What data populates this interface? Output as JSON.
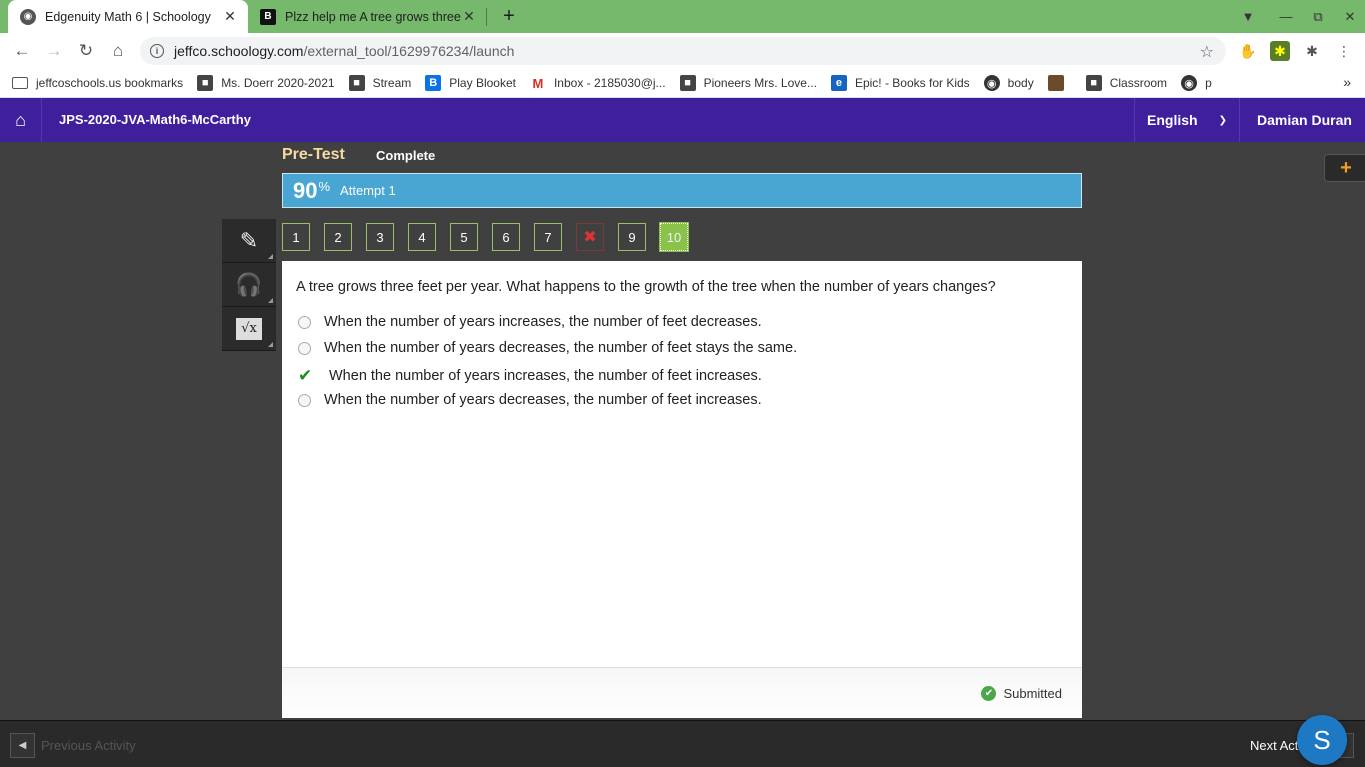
{
  "browser": {
    "tabs": [
      {
        "title": "Edgenuity Math 6 | Schoology",
        "active": true
      },
      {
        "title": "Plzz help me A tree grows three f",
        "active": false
      }
    ],
    "url_host": "jeffco.schoology.com",
    "url_path": "/external_tool/1629976234/launch",
    "bookmarks": [
      {
        "label": "jeffcoschools.us bookmarks",
        "icon": "folder-icon"
      },
      {
        "label": "Ms. Doerr 2020-2021",
        "icon": "classroom-icon"
      },
      {
        "label": "Stream",
        "icon": "classroom-icon"
      },
      {
        "label": "Play Blooket",
        "icon": "blooket-icon"
      },
      {
        "label": "Inbox - 2185030@j...",
        "icon": "gmail-icon"
      },
      {
        "label": "Pioneers Mrs. Love...",
        "icon": "classroom-icon"
      },
      {
        "label": "Epic! - Books for Kids",
        "icon": "epic-icon"
      },
      {
        "label": "body",
        "icon": "globe-icon"
      },
      {
        "label": "",
        "icon": "image-icon"
      },
      {
        "label": "Classroom",
        "icon": "classroom-icon"
      },
      {
        "label": "p",
        "icon": "globe-icon"
      }
    ]
  },
  "schoology": {
    "course": "JPS-2020-JVA-Math6-McCarthy",
    "language": "English",
    "user": "Damian Duran"
  },
  "activity": {
    "title": "Pre-Test",
    "status": "Complete",
    "score": "90",
    "score_unit": "%",
    "attempt": "Attempt 1",
    "questions": [
      {
        "label": "1",
        "state": "answered"
      },
      {
        "label": "2",
        "state": "answered"
      },
      {
        "label": "3",
        "state": "answered"
      },
      {
        "label": "4",
        "state": "answered"
      },
      {
        "label": "5",
        "state": "answered"
      },
      {
        "label": "6",
        "state": "answered"
      },
      {
        "label": "7",
        "state": "answered"
      },
      {
        "label": "",
        "state": "wrong"
      },
      {
        "label": "9",
        "state": "answered"
      },
      {
        "label": "10",
        "state": "current"
      }
    ],
    "question_text": "A tree grows three feet per year. What happens to the growth of the tree when the number of years changes?",
    "options": [
      {
        "text": "When the number of years increases, the number of feet decreases.",
        "selected": false
      },
      {
        "text": "When the number of years decreases, the number of feet stays the same.",
        "selected": false
      },
      {
        "text": "When the number of years increases, the number of feet increases.",
        "selected": true
      },
      {
        "text": "When the number of years decreases, the number of feet increases.",
        "selected": false
      }
    ],
    "submitted_label": "Submitted",
    "prev_label": "Previous Activity",
    "next_label": "Next Activity",
    "chat_bubble": "S"
  },
  "colors": {
    "tabstrip": "#76b86c",
    "schoology_header": "#3f1f9c",
    "score_bar": "#49a6d2",
    "question_current": "#8bc34a",
    "correct_check": "#1f8b1f"
  }
}
